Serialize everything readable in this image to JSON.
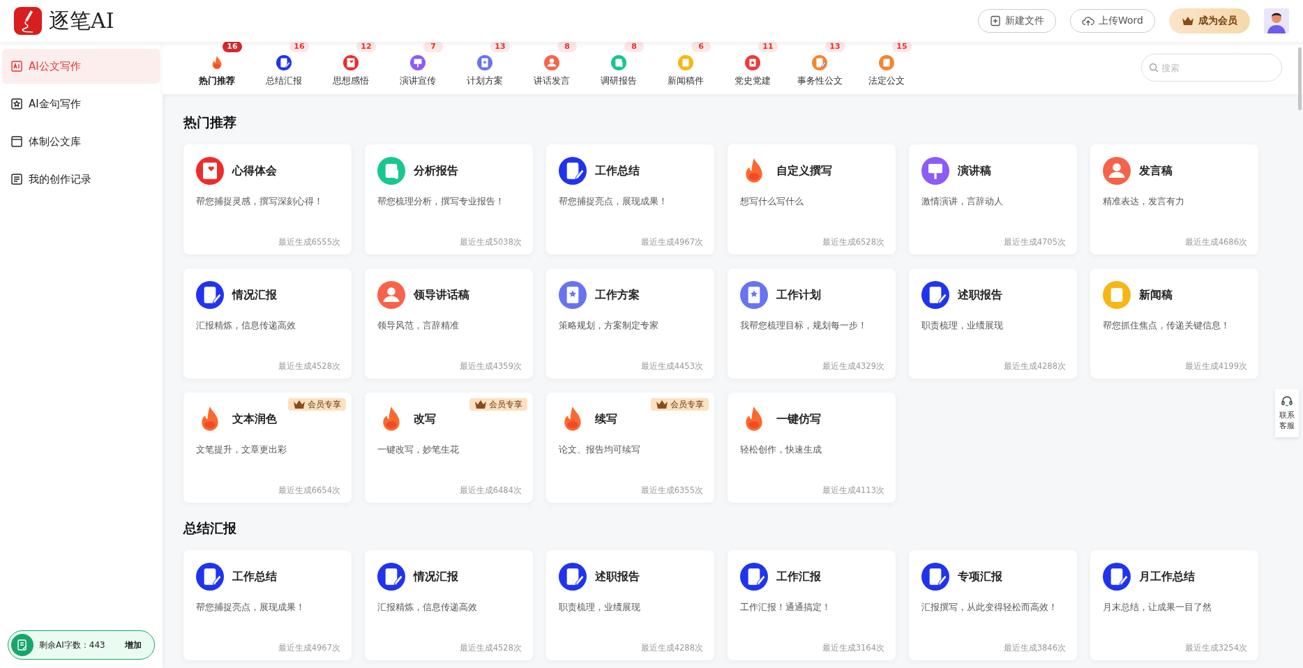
{
  "header": {
    "logo_text": "逐笔AI",
    "buttons": [
      {
        "label": "新建文件",
        "kind": "new"
      },
      {
        "label": "上传Word",
        "kind": "upload"
      }
    ],
    "vip_button": "成为会员"
  },
  "sidebar": {
    "items": [
      {
        "label": "AI公文写作",
        "kind": "ai",
        "selected": true
      },
      {
        "label": "AI金句写作",
        "kind": "star",
        "selected": false
      },
      {
        "label": "体制公文库",
        "kind": "folder",
        "selected": false
      },
      {
        "label": "我的创作记录",
        "kind": "record",
        "selected": false
      }
    ],
    "quota": {
      "label": "剩余AI字数：443",
      "action": "增加"
    }
  },
  "tabs": [
    {
      "label": "热门推荐",
      "count": "16",
      "kind": "fire",
      "selected": true
    },
    {
      "label": "总结汇报",
      "count": "16",
      "kind": "doc",
      "selected": false
    },
    {
      "label": "思想感悟",
      "count": "12",
      "kind": "heart",
      "selected": false
    },
    {
      "label": "演讲宣传",
      "count": "7",
      "kind": "speech",
      "selected": false
    },
    {
      "label": "计划方案",
      "count": "13",
      "kind": "plan",
      "selected": false
    },
    {
      "label": "讲话发言",
      "count": "8",
      "kind": "person",
      "selected": false
    },
    {
      "label": "调研报告",
      "count": "8",
      "kind": "scroll",
      "selected": false
    },
    {
      "label": "新闻稿件",
      "count": "6",
      "kind": "news",
      "selected": false
    },
    {
      "label": "党史党建",
      "count": "11",
      "kind": "party",
      "selected": false
    },
    {
      "label": "事务性公文",
      "count": "13",
      "kind": "affairs",
      "selected": false
    },
    {
      "label": "法定公文",
      "count": "15",
      "kind": "law",
      "selected": false
    }
  ],
  "search": {
    "placeholder": "搜索"
  },
  "sections": [
    {
      "title": "热门推荐",
      "cards": [
        {
          "title": "心得体会",
          "kind": "heart",
          "desc": "帮您捕捉灵感，撰写深刻心得！",
          "count": "最近生成6555次"
        },
        {
          "title": "分析报告",
          "kind": "scroll",
          "desc": "帮您梳理分析，撰写专业报告！",
          "count": "最近生成5038次"
        },
        {
          "title": "工作总结",
          "kind": "doc",
          "desc": "帮您捕捉亮点，展现成果！",
          "count": "最近生成4967次"
        },
        {
          "title": "自定义撰写",
          "kind": "fire",
          "desc": "想写什么写什么",
          "count": "最近生成6528次"
        },
        {
          "title": "演讲稿",
          "kind": "speech",
          "desc": "激情演讲，言辞动人",
          "count": "最近生成4705次"
        },
        {
          "title": "发言稿",
          "kind": "person",
          "desc": "精准表达，发言有力",
          "count": "最近生成4686次"
        },
        {
          "title": "情况汇报",
          "kind": "doc",
          "desc": "汇报精炼，信息传递高效",
          "count": "最近生成4528次"
        },
        {
          "title": "领导讲话稿",
          "kind": "person",
          "desc": "领导风范，言辞精准",
          "count": "最近生成4359次"
        },
        {
          "title": "工作方案",
          "kind": "plan",
          "desc": "策略规划，方案制定专家",
          "count": "最近生成4453次"
        },
        {
          "title": "工作计划",
          "kind": "plan",
          "desc": "我帮您梳理目标，规划每一步！",
          "count": "最近生成4329次"
        },
        {
          "title": "述职报告",
          "kind": "doc",
          "desc": "职责梳理，业绩展现",
          "count": "最近生成4288次"
        },
        {
          "title": "新闻稿",
          "kind": "news",
          "desc": "帮您抓住焦点，传递关键信息！",
          "count": "最近生成4199次"
        },
        {
          "title": "文本润色",
          "kind": "fire",
          "desc": "文笔提升，文章更出彩",
          "count": "最近生成6654次",
          "badge": "会员专享"
        },
        {
          "title": "改写",
          "kind": "fire",
          "desc": "一键改写，妙笔生花",
          "count": "最近生成6484次",
          "badge": "会员专享"
        },
        {
          "title": "续写",
          "kind": "fire",
          "desc": "论文、报告均可续写",
          "count": "最近生成6355次",
          "badge": "会员专享"
        },
        {
          "title": "一键仿写",
          "kind": "fire",
          "desc": "轻松创作，快速生成",
          "count": "最近生成4113次"
        }
      ]
    },
    {
      "title": "总结汇报",
      "cards": [
        {
          "title": "工作总结",
          "kind": "doc",
          "desc": "帮您捕捉亮点，展现成果！",
          "count": "最近生成4967次"
        },
        {
          "title": "情况汇报",
          "kind": "doc",
          "desc": "汇报精炼，信息传递高效",
          "count": "最近生成4528次"
        },
        {
          "title": "述职报告",
          "kind": "doc",
          "desc": "职责梳理，业绩展现",
          "count": "最近生成4288次"
        },
        {
          "title": "工作汇报",
          "kind": "doc",
          "desc": "工作汇报！通通搞定！",
          "count": "最近生成3164次"
        },
        {
          "title": "专项汇报",
          "kind": "doc",
          "desc": "汇报撰写，从此变得轻松而高效！",
          "count": "最近生成3846次"
        },
        {
          "title": "月工作总结",
          "kind": "doc",
          "desc": "月末总结，让成果一目了然",
          "count": "最近生成3254次"
        }
      ]
    }
  ],
  "support": {
    "label": "联系客服"
  }
}
